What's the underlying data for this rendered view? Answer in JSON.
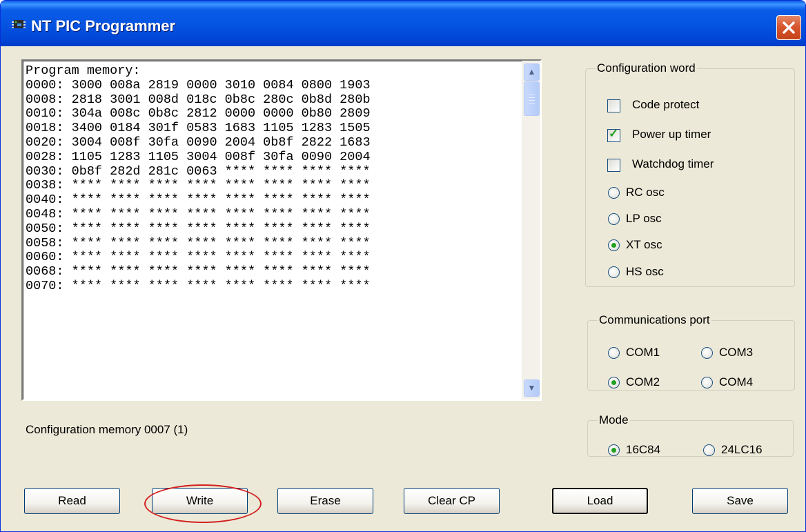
{
  "window": {
    "title": "NT PIC Programmer"
  },
  "memory": {
    "lines": [
      "Program memory:",
      "0000: 3000 008a 2819 0000 3010 0084 0800 1903",
      "0008: 2818 3001 008d 018c 0b8c 280c 0b8d 280b",
      "0010: 304a 008c 0b8c 2812 0000 0000 0b80 2809",
      "0018: 3400 0184 301f 0583 1683 1105 1283 1505",
      "0020: 3004 008f 30fa 0090 2004 0b8f 2822 1683",
      "0028: 1105 1283 1105 3004 008f 30fa 0090 2004",
      "0030: 0b8f 282d 281c 0063 **** **** **** ****",
      "0038: **** **** **** **** **** **** **** ****",
      "0040: **** **** **** **** **** **** **** ****",
      "0048: **** **** **** **** **** **** **** ****",
      "0050: **** **** **** **** **** **** **** ****",
      "0058: **** **** **** **** **** **** **** ****",
      "0060: **** **** **** **** **** **** **** ****",
      "0068: **** **** **** **** **** **** **** ****",
      "0070: **** **** **** **** **** **** **** ****"
    ]
  },
  "status": {
    "text": "Configuration memory 0007 (1)"
  },
  "config": {
    "legend": "Configuration word",
    "code_protect": {
      "label": "Code protect",
      "checked": false
    },
    "power_up_timer": {
      "label": "Power up timer",
      "checked": true
    },
    "watchdog_timer": {
      "label": "Watchdog timer",
      "checked": false
    },
    "osc": [
      {
        "label": "RC osc",
        "selected": false
      },
      {
        "label": "LP osc",
        "selected": false
      },
      {
        "label": "XT osc",
        "selected": true
      },
      {
        "label": "HS osc",
        "selected": false
      }
    ]
  },
  "comm": {
    "legend": "Communications port",
    "ports": [
      {
        "label": "COM1",
        "selected": false
      },
      {
        "label": "COM3",
        "selected": false
      },
      {
        "label": "COM2",
        "selected": true
      },
      {
        "label": "COM4",
        "selected": false
      }
    ]
  },
  "mode": {
    "legend": "Mode",
    "options": [
      {
        "label": "16C84",
        "selected": true
      },
      {
        "label": "24LC16",
        "selected": false
      }
    ]
  },
  "buttons": {
    "read": "Read",
    "write": "Write",
    "erase": "Erase",
    "clear_cp": "Clear CP",
    "load": "Load",
    "save": "Save"
  },
  "colors": {
    "title_bar": "#0553e1",
    "window_bg": "#ece9d8",
    "highlight_ring": "#d31f1f",
    "check_mark": "#21a121"
  },
  "icons": {
    "app": "app-chip-icon",
    "close": "close-x-icon",
    "scroll_up": "chevron-up-icon",
    "scroll_down": "chevron-down-icon"
  }
}
